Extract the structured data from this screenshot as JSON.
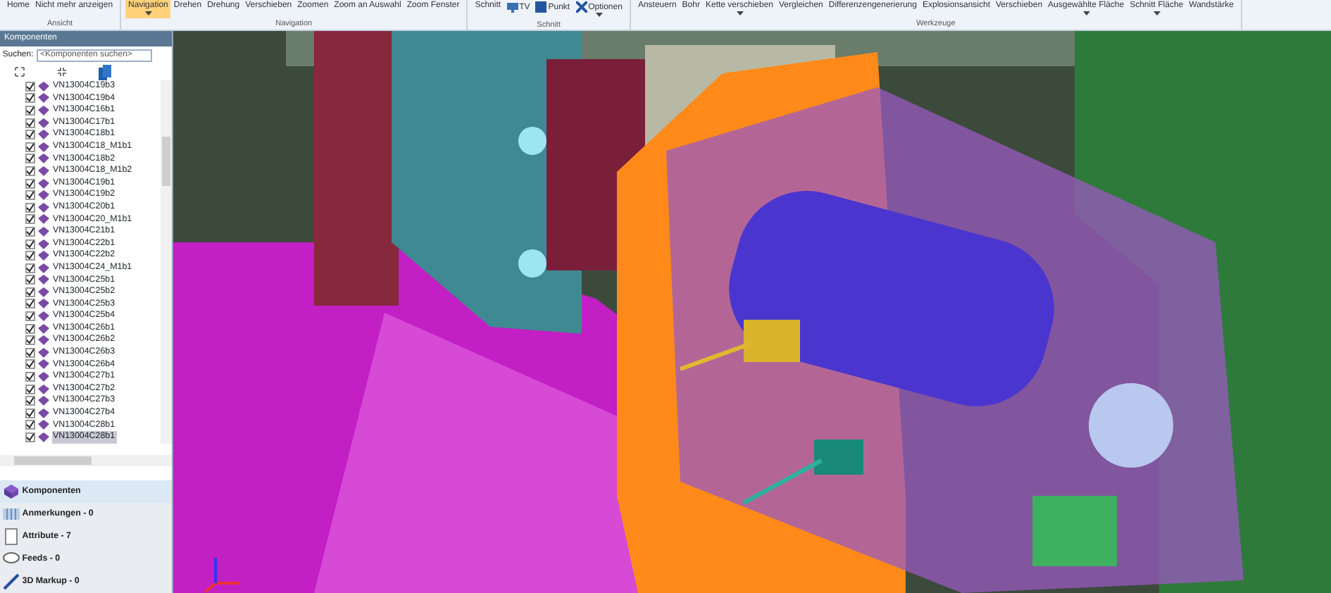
{
  "ribbon": {
    "groups": [
      {
        "label": "Ansicht",
        "buttons": [
          {
            "label": "Home",
            "selected": false,
            "dropdown": false
          },
          {
            "label": "Nicht mehr anzeigen",
            "selected": false,
            "dropdown": false
          }
        ]
      },
      {
        "label": "Navigation",
        "buttons": [
          {
            "label": "Navigation",
            "selected": true,
            "dropdown": true
          },
          {
            "label": "Drehen",
            "selected": false,
            "dropdown": false
          },
          {
            "label": "Drehung",
            "selected": false,
            "dropdown": false
          },
          {
            "label": "Verschieben",
            "selected": false,
            "dropdown": false
          },
          {
            "label": "Zoomen",
            "selected": false,
            "dropdown": false
          },
          {
            "label": "Zoom an Auswahl",
            "selected": false,
            "dropdown": false
          },
          {
            "label": "Zoom Fenster",
            "selected": false,
            "dropdown": false
          }
        ]
      },
      {
        "label": "Schnitt",
        "buttons": [
          {
            "label": "Schnitt",
            "selected": false,
            "dropdown": false
          },
          {
            "label": "TV",
            "selected": false,
            "dropdown": false
          },
          {
            "label": "Punkt",
            "selected": false,
            "dropdown": false
          },
          {
            "label": "Optionen",
            "selected": false,
            "dropdown": true
          }
        ]
      },
      {
        "label": "Werkzeuge",
        "buttons": [
          {
            "label": "Ansteuern",
            "selected": false,
            "dropdown": false
          },
          {
            "label": "Bohr",
            "selected": false,
            "dropdown": false
          },
          {
            "label": "Kette verschieben",
            "selected": false,
            "dropdown": true
          },
          {
            "label": "Vergleichen",
            "selected": false,
            "dropdown": false
          },
          {
            "label": "Differenzengenerierung",
            "selected": false,
            "dropdown": false
          },
          {
            "label": "Explosionsansicht",
            "selected": false,
            "dropdown": false
          },
          {
            "label": "Verschieben",
            "selected": false,
            "dropdown": false
          },
          {
            "label": "Ausgewählte Fläche",
            "selected": false,
            "dropdown": true
          },
          {
            "label": "Schnitt Fläche",
            "selected": false,
            "dropdown": true
          },
          {
            "label": "Wandstärke",
            "selected": false,
            "dropdown": false
          }
        ]
      }
    ]
  },
  "panel": {
    "title": "Komponenten",
    "search_label": "Suchen:",
    "search_placeholder": "<Komponenten suchen>",
    "tree": [
      {
        "label": "VN13004C19b3",
        "checked": true,
        "selected": false
      },
      {
        "label": "VN13004C19b4",
        "checked": true,
        "selected": false
      },
      {
        "label": "VN13004C16b1",
        "checked": true,
        "selected": false
      },
      {
        "label": "VN13004C17b1",
        "checked": true,
        "selected": false
      },
      {
        "label": "VN13004C18b1",
        "checked": true,
        "selected": false
      },
      {
        "label": "VN13004C18_M1b1",
        "checked": true,
        "selected": false
      },
      {
        "label": "VN13004C18b2",
        "checked": true,
        "selected": false
      },
      {
        "label": "VN13004C18_M1b2",
        "checked": true,
        "selected": false
      },
      {
        "label": "VN13004C19b1",
        "checked": true,
        "selected": false
      },
      {
        "label": "VN13004C19b2",
        "checked": true,
        "selected": false
      },
      {
        "label": "VN13004C20b1",
        "checked": true,
        "selected": false
      },
      {
        "label": "VN13004C20_M1b1",
        "checked": true,
        "selected": false
      },
      {
        "label": "VN13004C21b1",
        "checked": true,
        "selected": false
      },
      {
        "label": "VN13004C22b1",
        "checked": true,
        "selected": false
      },
      {
        "label": "VN13004C22b2",
        "checked": true,
        "selected": false
      },
      {
        "label": "VN13004C24_M1b1",
        "checked": true,
        "selected": false
      },
      {
        "label": "VN13004C25b1",
        "checked": true,
        "selected": false
      },
      {
        "label": "VN13004C25b2",
        "checked": true,
        "selected": false
      },
      {
        "label": "VN13004C25b3",
        "checked": true,
        "selected": false
      },
      {
        "label": "VN13004C25b4",
        "checked": true,
        "selected": false
      },
      {
        "label": "VN13004C26b1",
        "checked": true,
        "selected": false
      },
      {
        "label": "VN13004C26b2",
        "checked": true,
        "selected": false
      },
      {
        "label": "VN13004C26b3",
        "checked": true,
        "selected": false
      },
      {
        "label": "VN13004C26b4",
        "checked": true,
        "selected": false
      },
      {
        "label": "VN13004C27b1",
        "checked": true,
        "selected": false
      },
      {
        "label": "VN13004C27b2",
        "checked": true,
        "selected": false
      },
      {
        "label": "VN13004C27b3",
        "checked": true,
        "selected": false
      },
      {
        "label": "VN13004C27b4",
        "checked": true,
        "selected": false
      },
      {
        "label": "VN13004C28b1",
        "checked": true,
        "selected": false
      },
      {
        "label": "VN13004C28b1",
        "checked": true,
        "selected": true
      }
    ]
  },
  "tabs": [
    {
      "label": "Komponenten",
      "selected": true
    },
    {
      "label": "Anmerkungen - 0",
      "selected": false
    },
    {
      "label": "Attribute - 7",
      "selected": false
    },
    {
      "label": "Feeds - 0",
      "selected": false
    },
    {
      "label": "3D Markup - 0",
      "selected": false
    }
  ]
}
